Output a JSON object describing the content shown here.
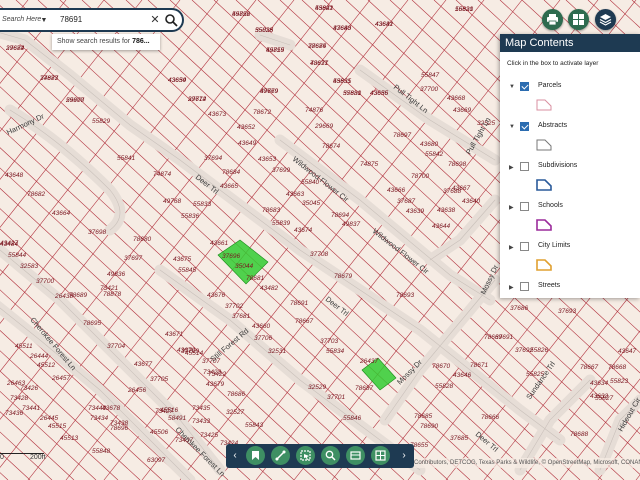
{
  "search": {
    "label": "Search Here",
    "value": "78691",
    "suggestion_prefix": "Show search results for ",
    "suggestion_term": "786..."
  },
  "top_buttons": [
    {
      "name": "print",
      "icon": "print-icon"
    },
    {
      "name": "basemap",
      "icon": "grid-icon"
    },
    {
      "name": "layers",
      "icon": "layers-icon"
    }
  ],
  "panel": {
    "title": "Map Contents",
    "hint": "Click in the box to activate layer",
    "layers": [
      {
        "name": "Parcels",
        "checked": true,
        "color": "#d98fa0"
      },
      {
        "name": "Abstracts",
        "checked": true,
        "color": "#777777"
      },
      {
        "name": "Subdivisions",
        "checked": false,
        "color": "#2a5a9a"
      },
      {
        "name": "Schools",
        "checked": false,
        "color": "#9b2b9b"
      },
      {
        "name": "City Limits",
        "checked": false,
        "color": "#e0a030"
      },
      {
        "name": "Streets",
        "checked": false,
        "color": ""
      }
    ]
  },
  "toolbar": {
    "prev": "‹",
    "next": "›",
    "tools": [
      "bookmark-icon",
      "measure-icon",
      "select-icon",
      "zoom-search-icon",
      "print-layout-icon",
      "table-icon"
    ]
  },
  "attribution": "Contributors, DETCOG, Texas Parks & Wildlife, © OpenStreetMap, Microsoft, CONANP",
  "scale": {
    "start": "0",
    "end": "200ft"
  },
  "map": {
    "highlight_color": "#33cc33",
    "streets": [
      "Deer Trl",
      "Deer Trl",
      "Still Forest Rd",
      "Wildwood Flower Cir",
      "Wildwood Flower Cir",
      "Pull Tight Ln",
      "Pull Tight Ln",
      "Harmony Dr",
      "Cherokee Forest Ln",
      "Cherokee Forest Ln",
      "Mossy Dr",
      "Mossy Dr",
      "Deer Trl",
      "Sundance Trl",
      "Hideout Cir"
    ],
    "parcels": [
      "49756",
      "43642",
      "16631",
      "43641",
      "29674",
      "35028",
      "43643",
      "49755",
      "78675",
      "74877",
      "78677",
      "43654",
      "29670",
      "29672",
      "49769",
      "55831",
      "43655",
      "55830",
      "55829",
      "43673",
      "74876",
      "29669",
      "78674",
      "43652",
      "78672",
      "74875",
      "55841",
      "37694",
      "43649",
      "43653",
      "74874",
      "78684",
      "37699",
      "55840",
      "43648",
      "49768",
      "43665",
      "43663",
      "78682",
      "78683",
      "35045",
      "78694",
      "43664",
      "55836",
      "55833",
      "55839",
      "49837",
      "43674",
      "37698",
      "78680",
      "43661",
      "37696",
      "35044",
      "37708",
      "37697",
      "43675",
      "78681",
      "78679",
      "49836",
      "55845",
      "43482",
      "78691",
      "37700",
      "78878",
      "43676",
      "37681",
      "78693",
      "78689",
      "37702",
      "43660",
      "78695",
      "43671",
      "78667",
      "37706",
      "37704",
      "37703",
      "32531",
      "43677",
      "37709",
      "55834",
      "37707",
      "26437",
      "37705",
      "32529",
      "43679",
      "37701",
      "78686",
      "78687",
      "32527",
      "55846",
      "55843",
      "78685",
      "55847",
      "37700",
      "43668",
      "43669",
      "32525",
      "78697",
      "43680",
      "55842",
      "78698",
      "43667",
      "78700",
      "43666",
      "37688",
      "37687",
      "43640",
      "43639",
      "43644",
      "43638",
      "37686",
      "37692",
      "37693",
      "37691",
      "78671",
      "78669",
      "55826",
      "78670",
      "43646",
      "55825",
      "55828",
      "78667",
      "55827",
      "78666",
      "78668",
      "43647",
      "43633",
      "78688",
      "78655",
      "55823",
      "78690",
      "37685",
      "43634",
      "55822",
      "55821",
      "55820",
      "43632",
      "37682",
      "55835",
      "37680",
      "55819",
      "37684",
      "37683",
      "43631",
      "43630",
      "55907",
      "37714",
      "37679",
      "43635",
      "43636",
      "37681"
    ],
    "left_parcels": [
      "43484",
      "32583",
      "43427",
      "55844",
      "26438",
      "45511",
      "26444",
      "45512",
      "26457",
      "26463",
      "73426",
      "73428",
      "73441",
      "73440",
      "73434",
      "73436",
      "26445",
      "45515",
      "45513",
      "73427",
      "45506",
      "26456",
      "73438",
      "58491",
      "73435",
      "73437",
      "73433",
      "73425",
      "73424",
      "73423",
      "73422",
      "73421",
      "78696",
      "43678",
      "45516",
      "45514",
      "43670",
      "55848",
      "63097"
    ]
  }
}
